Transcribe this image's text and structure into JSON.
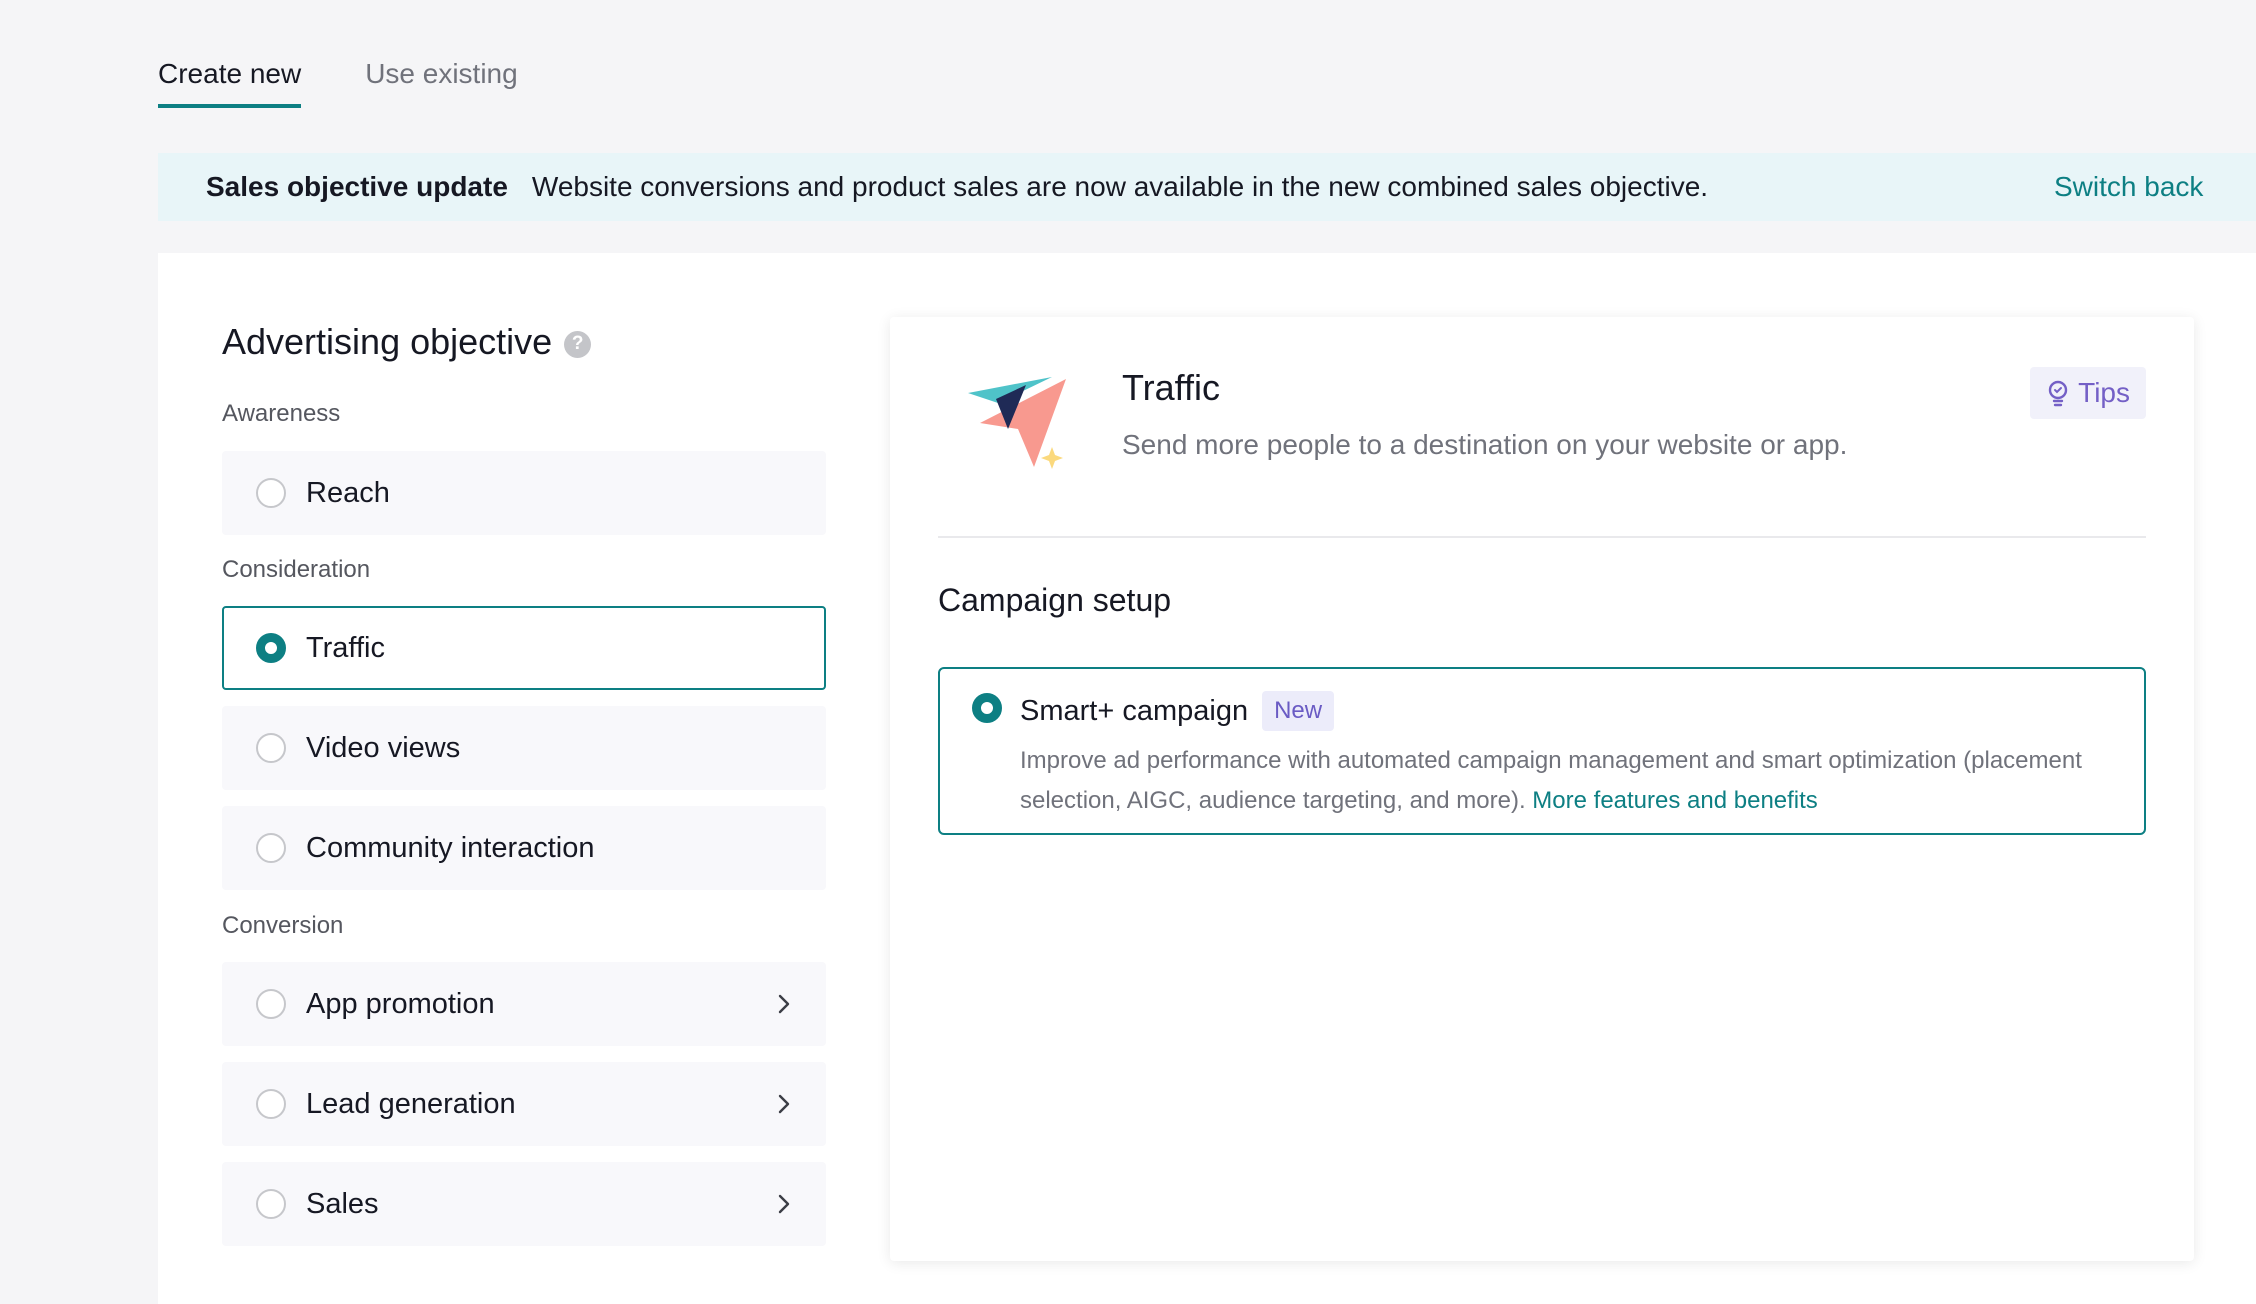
{
  "tabs": {
    "create_new": "Create new",
    "use_existing": "Use existing"
  },
  "banner": {
    "title": "Sales objective update",
    "text": "Website conversions and product sales are now available in the new combined sales objective.",
    "link": "Switch back"
  },
  "objective": {
    "title": "Advertising objective",
    "help_icon": "?",
    "groups": {
      "awareness": "Awareness",
      "consideration": "Consideration",
      "conversion": "Conversion"
    },
    "options": {
      "reach": "Reach",
      "traffic": "Traffic",
      "video_views": "Video views",
      "community_interaction": "Community interaction",
      "app_promotion": "App promotion",
      "lead_generation": "Lead generation",
      "sales": "Sales"
    },
    "selected": "Traffic"
  },
  "detail": {
    "title": "Traffic",
    "description": "Send more people to a destination on your website or app.",
    "tips_label": "Tips",
    "setup_title": "Campaign setup",
    "smart": {
      "title": "Smart+ campaign",
      "badge": "New",
      "description": "Improve ad performance with automated campaign management and smart optimization (placement selection, AIGC, audience targeting, and more).",
      "link": "More features and benefits"
    }
  },
  "colors": {
    "accent": "#0d7f83",
    "tips": "#7460c6",
    "banner_bg": "#e8f5f8"
  }
}
